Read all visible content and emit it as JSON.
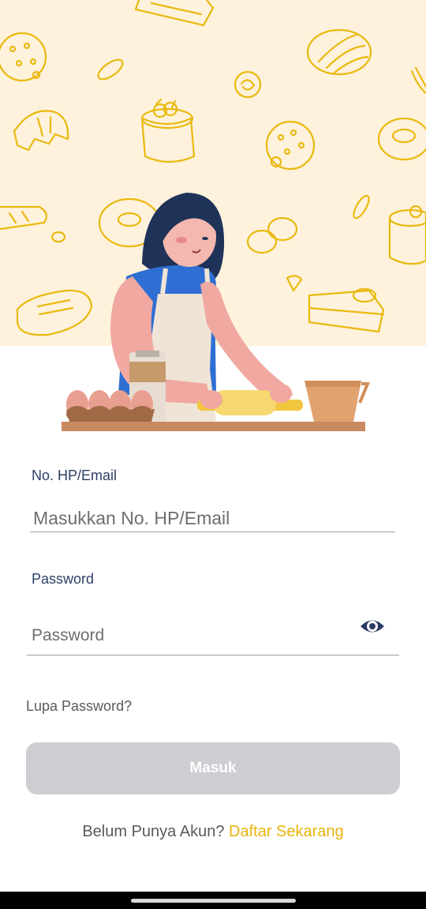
{
  "form": {
    "phone_email": {
      "label": "No. HP/Email",
      "placeholder": "Masukkan No. HP/Email",
      "value": ""
    },
    "password": {
      "label": "Password",
      "placeholder": "Password",
      "value": "",
      "toggle_icon": "eye-icon"
    },
    "forgot_password": "Lupa Password?",
    "submit_label": "Masuk"
  },
  "footer": {
    "no_account_text": "Belum Punya Akun?",
    "signup_link": "Daftar Sekarang"
  },
  "colors": {
    "hero_background": "#fff2dc",
    "doodle_yellow": "#e9b90e",
    "label_navy": "#2d3f66",
    "link_yellow": "#e9b30d",
    "button_disabled": "#cdced2"
  }
}
